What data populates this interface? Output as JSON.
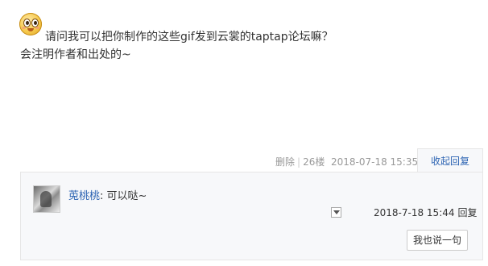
{
  "post": {
    "emoji_icon": "pleading-face-emoji-icon",
    "line1": "请问我可以把你制作的这些gif发到云裳的taptap论坛嘛？",
    "line2": "会注明作者和出处的~"
  },
  "post_meta": {
    "delete_label": "删除",
    "separator": "|",
    "floor": "26楼",
    "timestamp": "2018-07-18 15:35",
    "collapse_reply_label": "收起回复"
  },
  "reply": {
    "user": "莵桃桃",
    "colon": ":",
    "text": " 可以哒~",
    "timestamp": "2018-7-18 15:44",
    "reply_label": "回复",
    "dropdown_icon": "chevron-down-icon"
  },
  "say_button_label": "我也说一句",
  "colors": {
    "link_blue": "#2d64b3",
    "meta_gray": "#999999",
    "reply_bg": "#f7f8fa",
    "border": "#e6e6e6"
  }
}
